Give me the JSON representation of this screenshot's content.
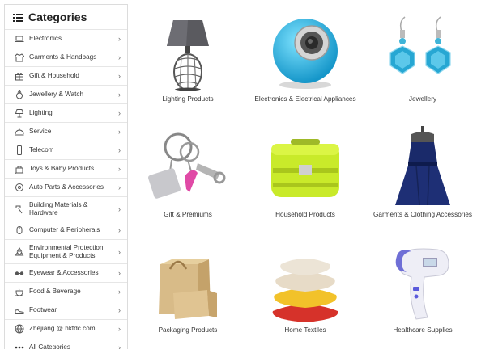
{
  "sidebar": {
    "title": "Categories",
    "items": [
      {
        "label": "Electronics",
        "icon": "laptop-icon"
      },
      {
        "label": "Garments & Handbags",
        "icon": "shirt-icon"
      },
      {
        "label": "Gift & Household",
        "icon": "gift-icon"
      },
      {
        "label": "Jewellery & Watch",
        "icon": "ring-icon"
      },
      {
        "label": "Lighting",
        "icon": "lamp-icon"
      },
      {
        "label": "Service",
        "icon": "service-icon"
      },
      {
        "label": "Telecom",
        "icon": "phone-icon"
      },
      {
        "label": "Toys & Baby Products",
        "icon": "toy-icon"
      },
      {
        "label": "Auto Parts & Accessories",
        "icon": "car-icon"
      },
      {
        "label": "Building Materials & Hardware",
        "icon": "hammer-icon"
      },
      {
        "label": "Computer & Peripherals",
        "icon": "mouse-icon"
      },
      {
        "label": "Environmental Protection Equipment & Products",
        "icon": "recycle-icon"
      },
      {
        "label": "Eyewear & Accessories",
        "icon": "glasses-icon"
      },
      {
        "label": "Food & Beverage",
        "icon": "food-icon"
      },
      {
        "label": "Footwear",
        "icon": "shoe-icon"
      },
      {
        "label": "Zhejiang @ hktdc.com",
        "icon": "globe-icon"
      },
      {
        "label": "All Categories",
        "icon": "dots-icon"
      }
    ],
    "chevron": "›"
  },
  "products": [
    {
      "label": "Lighting Products",
      "icon": "table-lamp-image"
    },
    {
      "label": "Electronics & Electrical Appliances",
      "icon": "speaker-image"
    },
    {
      "label": "Jewellery",
      "icon": "earrings-image"
    },
    {
      "label": "Gift & Premiums",
      "icon": "keychain-image"
    },
    {
      "label": "Household Products",
      "icon": "lunchbox-image"
    },
    {
      "label": "Garments & Clothing Accessories",
      "icon": "dress-image"
    },
    {
      "label": "Packaging Products",
      "icon": "paper-bag-image"
    },
    {
      "label": "Home Textiles",
      "icon": "pillows-image"
    },
    {
      "label": "Healthcare Supplies",
      "icon": "thermometer-image"
    }
  ]
}
